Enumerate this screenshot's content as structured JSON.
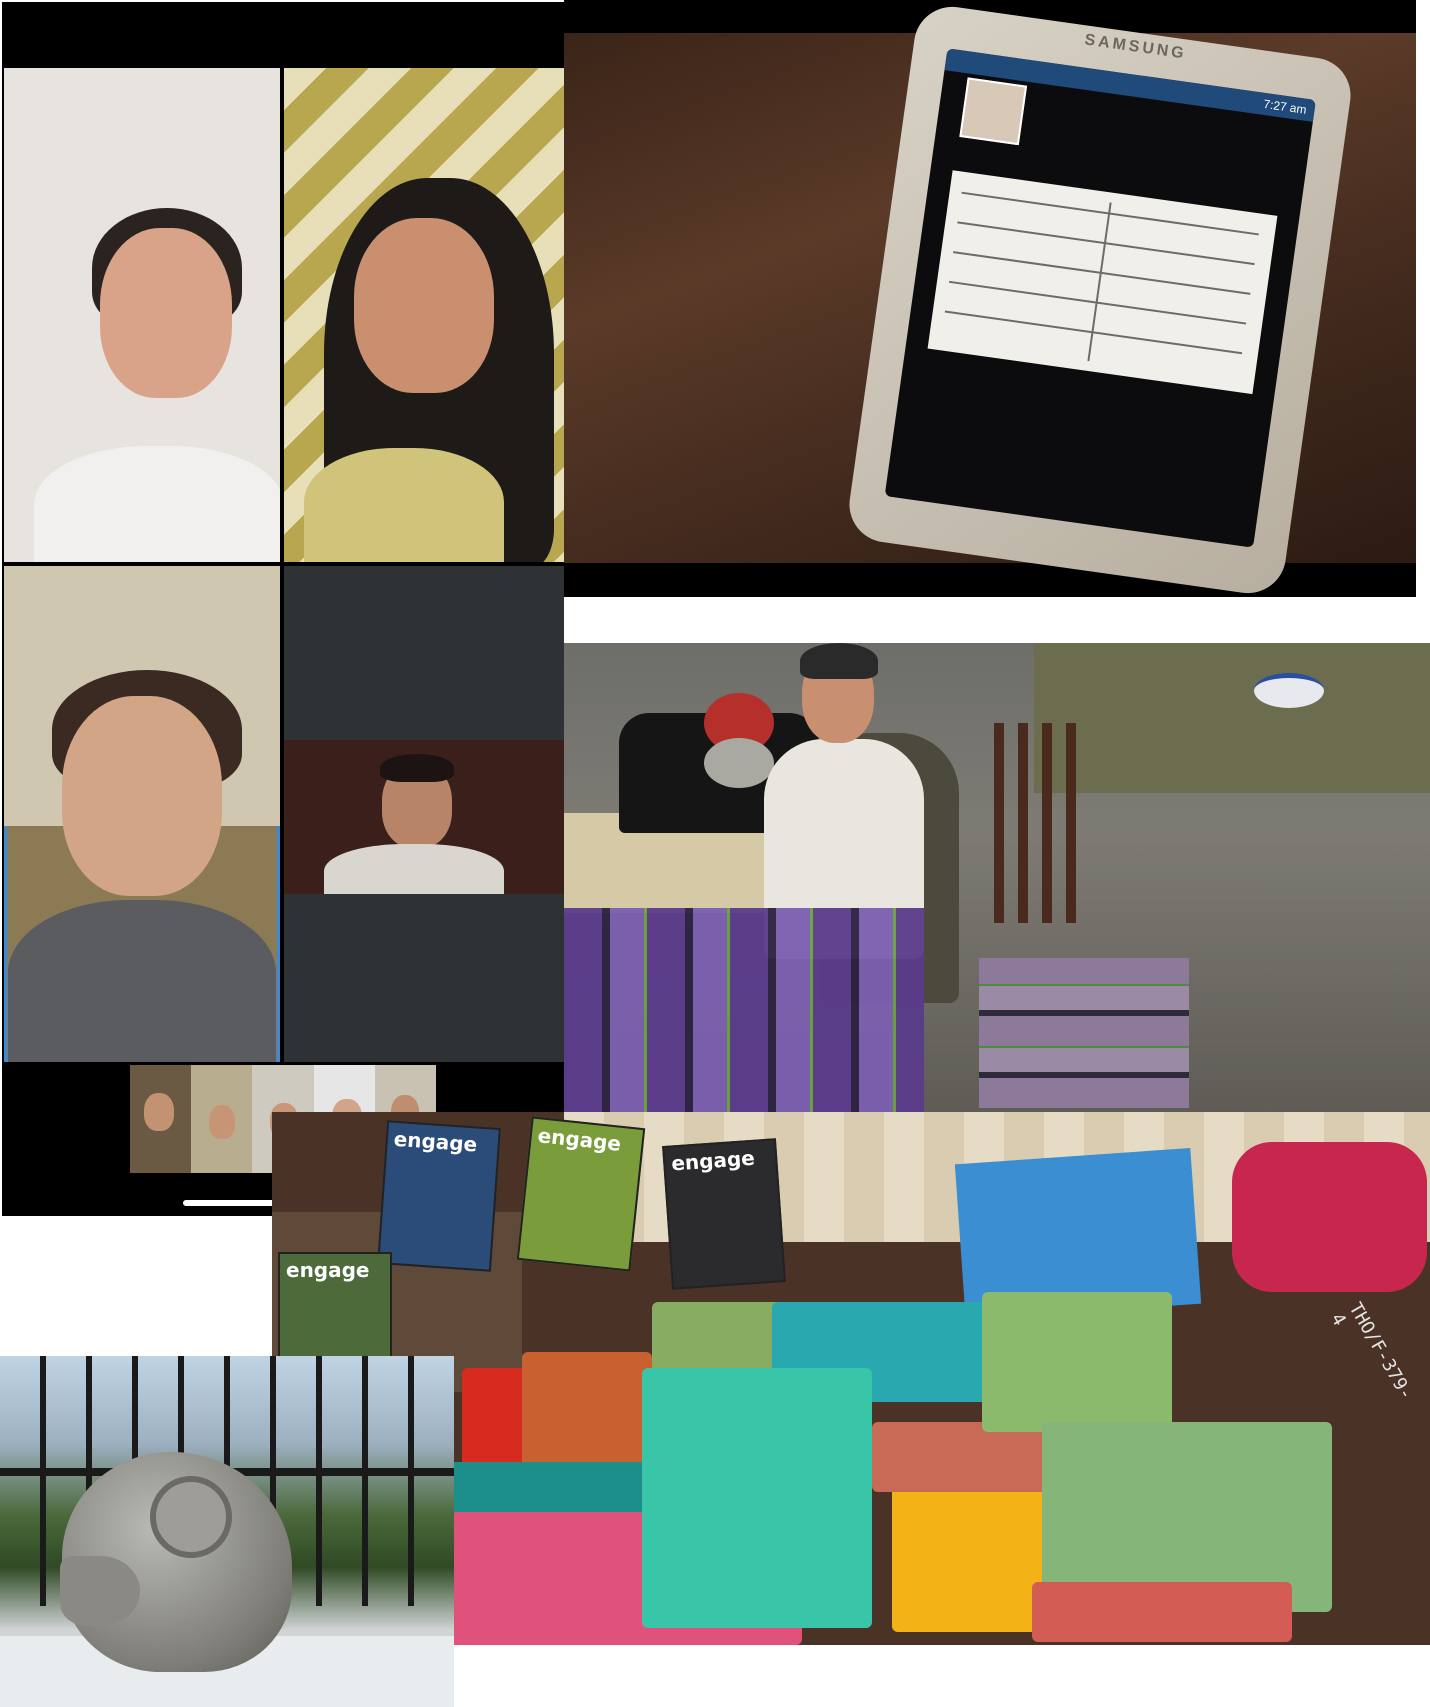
{
  "video_call": {
    "participants": [
      {
        "id": "top-left"
      },
      {
        "id": "top-right"
      },
      {
        "id": "active-speaker"
      },
      {
        "id": "right-middle"
      }
    ],
    "thumbnail_strip": {
      "count": 5
    }
  },
  "phone_photo": {
    "phone_brand": "SAMSUNG",
    "status_time": "7:27 am"
  },
  "scarves_photo": {
    "magazine_titles": [
      "engage",
      "engage",
      "engage",
      "engage"
    ],
    "desk_label": "THO/F-379-4"
  }
}
